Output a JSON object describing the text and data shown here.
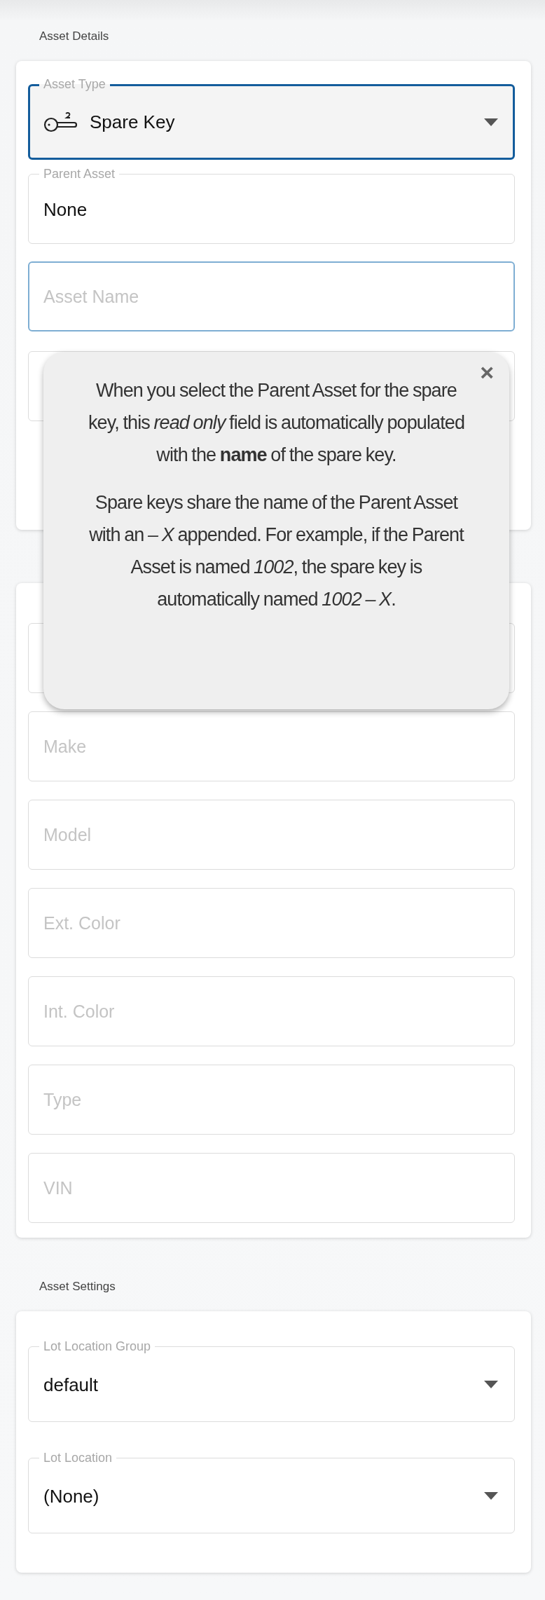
{
  "sections": [
    {
      "title": "Asset Details",
      "fields": [
        {
          "kind": "select",
          "label": "Asset Type",
          "value": "Spare Key",
          "has_icon": true,
          "focused": true,
          "hovered": false
        },
        {
          "kind": "text",
          "label": "Parent Asset",
          "value": "None",
          "focused": false,
          "hovered": false
        },
        {
          "kind": "text",
          "placeholder": "Asset Name",
          "focused": false,
          "hovered": true
        },
        {
          "kind": "text",
          "focused": false,
          "hovered": false
        }
      ]
    },
    {
      "fields": [
        {
          "kind": "text",
          "focused": false,
          "hovered": false
        },
        {
          "kind": "text",
          "placeholder": "Make",
          "focused": false,
          "hovered": false
        },
        {
          "kind": "text",
          "placeholder": "Model",
          "focused": false,
          "hovered": false
        },
        {
          "kind": "text",
          "placeholder": "Ext. Color",
          "focused": false,
          "hovered": false
        },
        {
          "kind": "text",
          "placeholder": "Int. Color",
          "focused": false,
          "hovered": false
        },
        {
          "kind": "text",
          "placeholder": "Type",
          "focused": false,
          "hovered": false
        },
        {
          "kind": "text",
          "placeholder": "VIN",
          "focused": false,
          "hovered": false
        }
      ]
    },
    {
      "title": "Asset Settings",
      "fields": [
        {
          "kind": "select",
          "label": "Lot Location Group",
          "value": "default",
          "focused": false,
          "hovered": false
        },
        {
          "kind": "select",
          "label": "Lot Location",
          "value": "(None)",
          "focused": false,
          "hovered": false
        }
      ]
    }
  ],
  "tooltip": {
    "close": "×",
    "paragraphs": [
      "When you select the Parent Asset for the spare key, this *read only* field is automatically populated with the **name** of the spare key.",
      "Spare keys share the name of the Parent Asset with an *– X* appended. For example, if the Parent Asset is named *1002*, the spare key is automatically named *1002 – X*."
    ]
  }
}
